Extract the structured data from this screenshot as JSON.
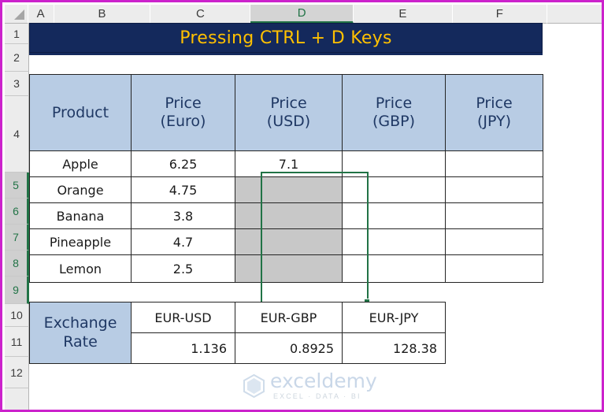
{
  "spreadsheet": {
    "column_headers": [
      "A",
      "B",
      "C",
      "D",
      "E",
      "F"
    ],
    "selected_column": "D",
    "row_headers": [
      "1",
      "2",
      "3",
      "4",
      "5",
      "6",
      "7",
      "8",
      "9",
      "10",
      "11",
      "12"
    ],
    "selected_rows": [
      "5",
      "6",
      "7",
      "8",
      "9"
    ],
    "selection_range": "D5:D9",
    "select_all_icon": "select-all-triangle-icon"
  },
  "title_banner": {
    "text": "Pressing CTRL + D Keys",
    "background_color": "#14295c",
    "text_color": "#ffc000"
  },
  "main_table": {
    "headers": [
      "Product",
      "Price\n(Euro)",
      "Price\n(USD)",
      "Price\n(GBP)",
      "Price\n(JPY)"
    ],
    "header_lines": [
      [
        "Product",
        ""
      ],
      [
        "Price",
        "(Euro)"
      ],
      [
        "Price",
        "(USD)"
      ],
      [
        "Price",
        "(GBP)"
      ],
      [
        "Price",
        "(JPY)"
      ]
    ],
    "header_background": "#b8cce4",
    "rows": [
      {
        "product": "Apple",
        "price_euro": "6.25",
        "price_usd": "7.1",
        "price_gbp": "",
        "price_jpy": "",
        "usd_filled": true
      },
      {
        "product": "Orange",
        "price_euro": "4.75",
        "price_usd": "",
        "price_gbp": "",
        "price_jpy": "",
        "usd_filled": false
      },
      {
        "product": "Banana",
        "price_euro": "3.8",
        "price_usd": "",
        "price_gbp": "",
        "price_jpy": "",
        "usd_filled": false
      },
      {
        "product": "Pineapple",
        "price_euro": "4.7",
        "price_usd": "",
        "price_gbp": "",
        "price_jpy": "",
        "usd_filled": false
      },
      {
        "product": "Lemon",
        "price_euro": "2.5",
        "price_usd": "",
        "price_gbp": "",
        "price_jpy": "",
        "usd_filled": false
      }
    ]
  },
  "rate_table": {
    "label_lines": [
      "Exchange",
      "Rate"
    ],
    "pairs": [
      "EUR-USD",
      "EUR-GBP",
      "EUR-JPY"
    ],
    "values": [
      "1.136",
      "0.8925",
      "128.38"
    ],
    "label_background": "#b8cce4"
  },
  "watermark": {
    "main": "exceldemy",
    "sub": "EXCEL · DATA · BI",
    "color": "#c9d7e8"
  },
  "colors": {
    "selection_green": "#217346",
    "selected_fill_grey": "#c8c8c8",
    "frame_magenta": "#cc22cc",
    "header_blue": "#b8cce4"
  }
}
